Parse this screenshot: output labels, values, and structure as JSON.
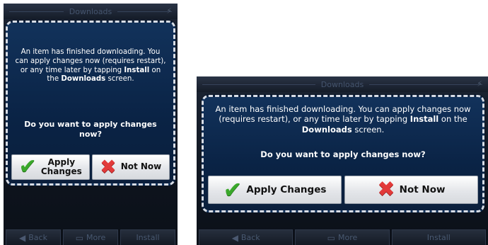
{
  "screen_small": {
    "title": "Downloads",
    "message_parts": [
      "An item has finished downloading. You can apply changes now (requires restart), or any time later by tapping ",
      "Install",
      " on the ",
      "Downloads",
      " screen."
    ],
    "question": "Do you want to apply changes now?",
    "apply_label": "Apply Changes",
    "notnow_label": "Not Now",
    "bottom": {
      "back": "Back",
      "more": "More",
      "install": "Install"
    }
  },
  "screen_large": {
    "title": "Downloads",
    "message_parts": [
      "An item has finished downloading. You can apply changes now (requires restart), or any time later by tapping ",
      "Install",
      " on the ",
      "Downloads",
      " screen."
    ],
    "question": "Do you want to apply changes now?",
    "apply_label": "Apply Changes",
    "notnow_label": "Not Now",
    "bottom": {
      "back": "Back",
      "more": "More",
      "install": "Install"
    }
  },
  "icons": {
    "apply": "check-icon",
    "notnow": "cross-icon",
    "back": "back-arrow-icon",
    "more": "more-icon"
  },
  "colors": {
    "dialog_bg": "#0a2345",
    "apply_check": "#3aa82b",
    "notnow_cross": "#e23a3a"
  }
}
